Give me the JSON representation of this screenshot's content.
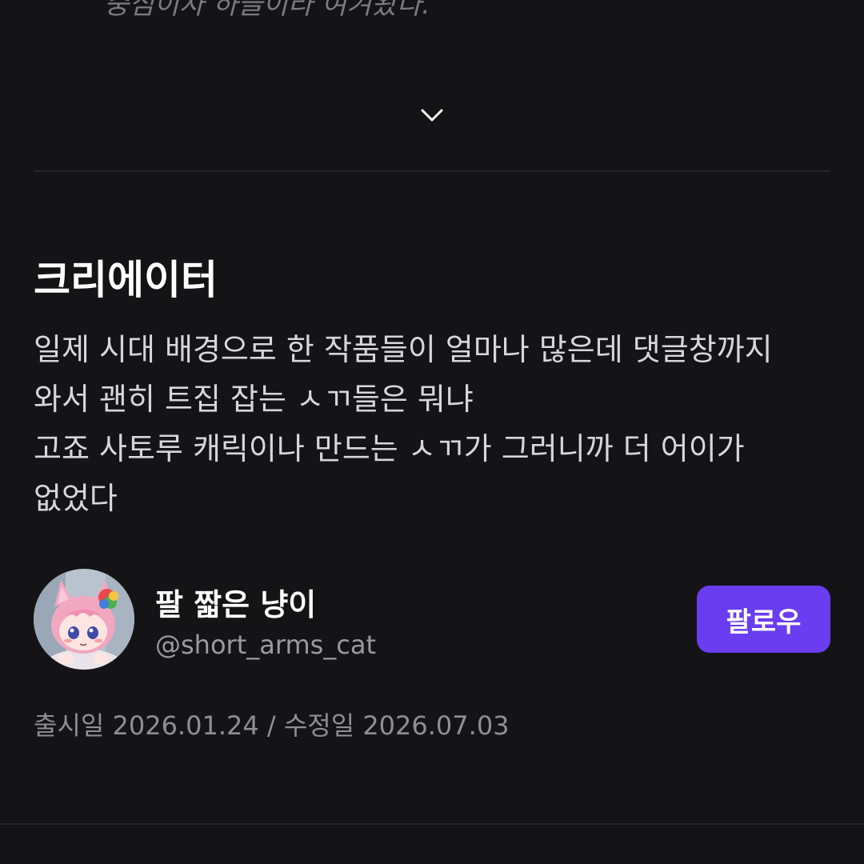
{
  "cut_off_text": "중심이자 하늘이라 여겨왔다.",
  "creator_section": {
    "title": "크리에이터",
    "description_lines": [
      "일제 시대 배경으로 한 작품들이 얼마나 많은데 댓글창까지",
      "와서 괜히 트집 잡는 ㅅㄲ들은 뭐냐",
      "고죠 사토루 캐릭이나 만드는 ㅅㄲ가 그러니까 더 어이가",
      "없었다"
    ],
    "creator": {
      "name": "팔 짧은 냥이",
      "handle": "@short_arms_cat",
      "avatar_icon": "cat-girl-avatar"
    },
    "follow_label": "팔로우",
    "dates": "출시일 2026.01.24 / 수정일 2026.07.03"
  },
  "colors": {
    "background": "#141416",
    "accent": "#6a3df0",
    "text_primary": "#ffffff",
    "text_secondary": "#9a9aa0"
  },
  "icons": {
    "expand": "chevron-down-icon"
  }
}
